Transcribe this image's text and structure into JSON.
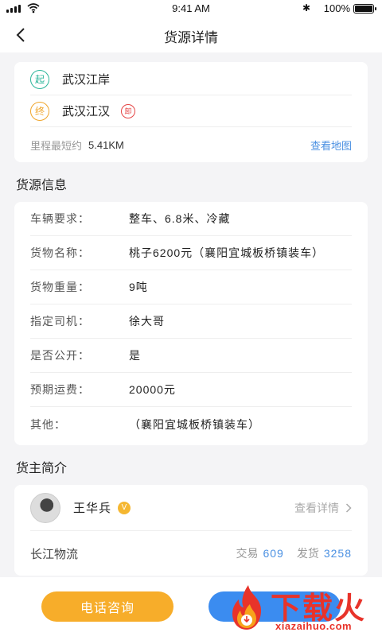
{
  "status": {
    "time": "9:41 AM",
    "battery": "100%"
  },
  "nav": {
    "title": "货源详情"
  },
  "route": {
    "start_badge": "起",
    "start_place": "武汉江岸",
    "end_badge": "终",
    "end_place": "武汉江汉",
    "unload_icon_text": "卸",
    "distance_label": "里程最短约",
    "distance_value": "5.41KM",
    "map_link": "查看地图"
  },
  "cargo_section": {
    "title": "货源信息",
    "rows": [
      {
        "label": "车辆要求：",
        "value": "整车、6.8米、冷藏"
      },
      {
        "label": "货物名称：",
        "value": "桃子6200元（襄阳宜城板桥镇装车）"
      },
      {
        "label": "货物重量：",
        "value": "9吨"
      },
      {
        "label": "指定司机：",
        "value": "徐大哥"
      },
      {
        "label": "是否公开：",
        "value": "是"
      },
      {
        "label": "预期运费：",
        "value": "20000元"
      },
      {
        "label": "其他：",
        "value": "（襄阳宜城板桥镇装车）"
      }
    ]
  },
  "owner_section": {
    "title": "货主简介",
    "name": "王华兵",
    "vip_badge": "V",
    "detail_link": "查看详情",
    "company": "长江物流",
    "trade_label": "交易",
    "trade_count": "609",
    "ship_label": "发货",
    "ship_count": "3258"
  },
  "actions": {
    "call_label": "电话咨询"
  },
  "watermark": {
    "main": "下载火",
    "sub": "xiazaihuo.com"
  },
  "colors": {
    "accent_orange": "#f7ad2a",
    "link_blue": "#4a90e2",
    "start_green": "#2bb59a",
    "watermark_red": "#e8332a"
  }
}
